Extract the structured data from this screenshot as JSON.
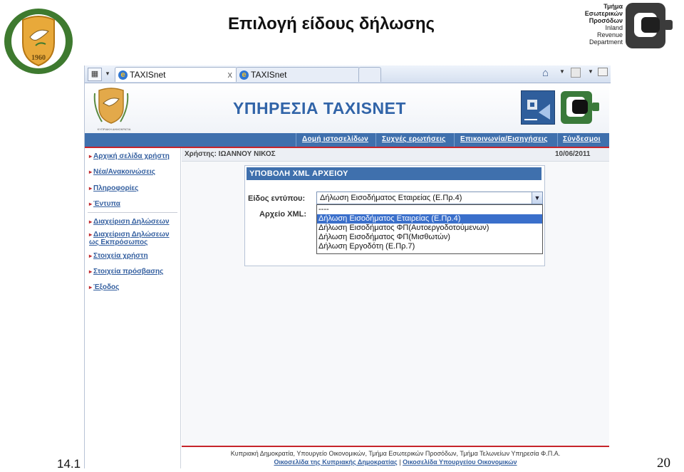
{
  "slide": {
    "title": "Επιλογή είδους δήλωσης",
    "ird": {
      "line1": "Τμήμα",
      "line2": "Εσωτερικών",
      "line3": "Προσόδων",
      "line4": "Inland",
      "line5": "Revenue",
      "line6": "Department"
    },
    "date_fragment": "14.1",
    "page_number": "20"
  },
  "browser": {
    "tabs": [
      {
        "label": "TAXISnet",
        "active": true
      },
      {
        "label": "TAXISnet",
        "active": false
      }
    ],
    "close_glyph": "x"
  },
  "site": {
    "title": "ΥΠΗΡΕΣΙΑ TAXISNET",
    "emblem_caption": "ΚΥΠΡΙΑΚΗ ΔΗΜΟΚΡΑΤΙΑ",
    "nav": [
      "Δομή ιστοσελίδων",
      "Συχνές ερωτήσεις",
      "Επικοινωνία/Εισηγήσεις",
      "Σύνδεσμοι"
    ],
    "menu": [
      "Αρχική σελίδα χρήστη",
      "Νέα/Ανακοινώσεις",
      "Πληροφορίες",
      "Έντυπα",
      "Διαχείριση Δηλώσεων",
      "Διαχείριση Δηλώσεων ως Εκπρόσωπος",
      "Στοιχεία χρήστη",
      "Στοιχεία πρόσβασης",
      "Έξοδος"
    ],
    "user": "Χρήστης: ΙΩΑΝΝΟΥ ΝΙΚΟΣ",
    "date": "10/06/2011",
    "panel": {
      "title": "ΥΠΟΒΟΛΗ XML ΑΡΧΕΙΟΥ",
      "type_label": "Είδος εντύπου:",
      "xml_label": "Αρχείο XML:",
      "selected": "Δήλωση Εισοδήματος Εταιρείας (Ε.Πρ.4)",
      "options": [
        "----",
        "Δήλωση Εισοδήματος Εταιρείας (Ε.Πρ.4)",
        "Δήλωση Εισοδήματος ΦΠ(Αυτοεργοδοτούμενων)",
        "Δήλωση Εισοδήματος ΦΠ(Μισθωτών)",
        "Δήλωση Εργοδότη (Ε.Πρ.7)"
      ],
      "highlighted_index": 1
    },
    "footer": {
      "line1": "Κυπριακή Δημοκρατία, Υπουργείο Οικονομικών, Τμήμα Εσωτερικών Προσόδων, Τμήμα Τελωνείων Υπηρεσία Φ.Π.Α.",
      "link1": "Οικοσελίδα της Κυπριακής Δημοκρατίας",
      "separator": "|",
      "link2": "Οικοσελίδα Υπουργείου Οικονομικών"
    }
  },
  "colors": {
    "nav_blue": "#3f70ad",
    "accent_red": "#c6242a",
    "selection_blue": "#3a6fcb"
  }
}
